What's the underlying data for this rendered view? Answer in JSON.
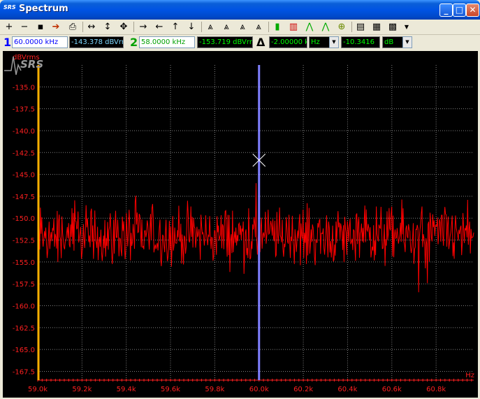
{
  "window": {
    "title": "Spectrum",
    "logo_text": "SRS",
    "buttons": [
      "minimize",
      "maximize",
      "close"
    ]
  },
  "toolbar": {
    "icons": [
      "zoom-in-icon",
      "zoom-out-icon",
      "save-icon",
      "export-icon",
      "print-icon",
      "fit-horizontal-icon",
      "fit-vertical-icon",
      "fit-all-icon",
      "arrow-right-icon",
      "arrow-left-icon",
      "arrow-up-icon",
      "arrow-down-icon",
      "marker-peak-icon",
      "marker-search-icon",
      "marker-max-icon",
      "marker-min-icon",
      "color-bars-icon",
      "chart-props-icon",
      "peak-left-icon",
      "peak-right-icon",
      "target-icon",
      "copy-icon",
      "table-icon",
      "calculator-icon",
      "menu-dropdown-icon"
    ]
  },
  "readout": {
    "marker1_label": "1",
    "marker1_freq": "60.0000 kHz",
    "marker1_value": "-143.378 dBVrms",
    "marker2_label": "2",
    "marker2_freq": "58.0000 kHz",
    "marker2_value": "-153.719 dBVrms",
    "delta_symbol": "Δ",
    "delta_freq": "-2.00000 kHz",
    "delta_freq_unit": "Hz",
    "delta_value": "-10.3416",
    "delta_value_unit": "dB"
  },
  "colors": {
    "trace": "#ff0000",
    "axis_text": "#ff2020",
    "grid": "#808080",
    "marker1": "#8080ff",
    "marker2": "#ffb000",
    "readout_blue": "#0000ff",
    "readout_green": "#00c000"
  },
  "chart_data": {
    "type": "line",
    "ylabel": "dBVrms",
    "xlabel": "Hz",
    "xlim": [
      59000,
      60970
    ],
    "ylim": [
      -168.5,
      -132.5
    ],
    "y_ticks": [
      -135.0,
      -137.5,
      -140.0,
      -142.5,
      -145.0,
      -147.5,
      -150.0,
      -152.5,
      -155.0,
      -157.5,
      -160.0,
      -162.5,
      -165.0,
      -167.5
    ],
    "y_tick_labels": [
      "-135.0",
      "-137.5",
      "-140.0",
      "-142.5",
      "-145.0",
      "-147.5",
      "-150.0",
      "-152.5",
      "-155.0",
      "-157.5",
      "-160.0",
      "-162.5",
      "-165.0",
      "-167.5"
    ],
    "x_ticks": [
      59000,
      59200,
      59400,
      59600,
      59800,
      60000,
      60200,
      60400,
      60600,
      60800
    ],
    "x_tick_labels": [
      "59.0k",
      "59.2k",
      "59.4k",
      "59.6k",
      "59.8k",
      "60.0k",
      "60.2k",
      "60.4k",
      "60.6k",
      "60.8k"
    ],
    "grid": true,
    "noise_floor": -152.0,
    "noise_spread": [
      -158.5,
      -146.0
    ],
    "markers": [
      {
        "name": "1",
        "x": 60000,
        "y": -143.378
      },
      {
        "name": "2",
        "x": 59000,
        "y": -153.719
      }
    ]
  }
}
